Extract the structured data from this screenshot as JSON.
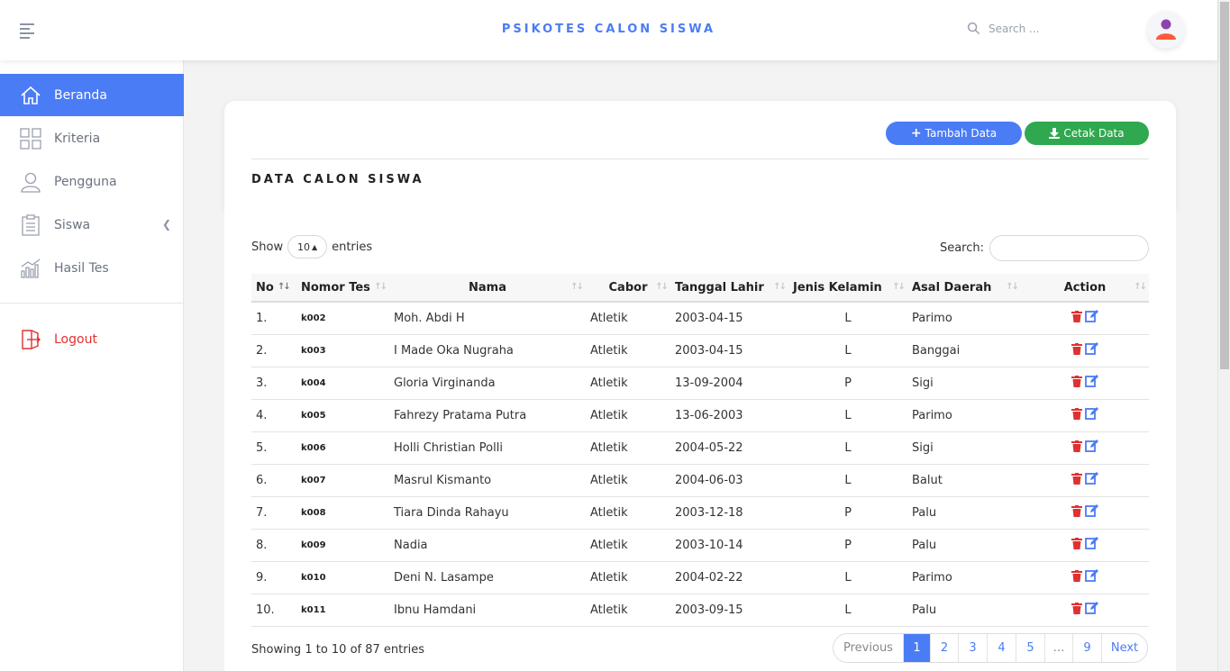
{
  "app": {
    "title": "PSIKOTES CALON SISWA"
  },
  "header": {
    "search_placeholder": "Search ..."
  },
  "sidebar": {
    "items": [
      {
        "label": "Beranda",
        "icon": "home-icon"
      },
      {
        "label": "Kriteria",
        "icon": "grid-icon"
      },
      {
        "label": "Pengguna",
        "icon": "user-icon"
      },
      {
        "label": "Siswa",
        "icon": "clipboard-icon"
      },
      {
        "label": "Hasil Tes",
        "icon": "bar-chart-icon"
      }
    ],
    "logout": "Logout"
  },
  "card": {
    "add_label": "Tambah Data",
    "print_label": "Cetak Data",
    "title": "DATA CALON SISWA"
  },
  "table": {
    "show_label": "Show",
    "entries_label": "entries",
    "page_size": "10",
    "search_label": "Search:",
    "columns": [
      "No",
      "Nomor Tes",
      "Nama",
      "Cabor",
      "Tanggal Lahir",
      "Jenis Kelamin",
      "Asal Daerah",
      "Action"
    ],
    "rows": [
      {
        "no": "1.",
        "code": "k002",
        "nama": "Moh. Abdi H",
        "cabor": "Atletik",
        "tgl": "2003-04-15",
        "jk": "L",
        "asal": "Parimo"
      },
      {
        "no": "2.",
        "code": "k003",
        "nama": "I Made Oka Nugraha",
        "cabor": "Atletik",
        "tgl": "2003-04-15",
        "jk": "L",
        "asal": "Banggai"
      },
      {
        "no": "3.",
        "code": "k004",
        "nama": "Gloria Virginanda",
        "cabor": "Atletik",
        "tgl": "13-09-2004",
        "jk": "P",
        "asal": "Sigi"
      },
      {
        "no": "4.",
        "code": "k005",
        "nama": "Fahrezy Pratama Putra",
        "cabor": "Atletik",
        "tgl": "13-06-2003",
        "jk": "L",
        "asal": "Parimo"
      },
      {
        "no": "5.",
        "code": "k006",
        "nama": "Holli Christian Polli",
        "cabor": "Atletik",
        "tgl": "2004-05-22",
        "jk": "L",
        "asal": "Sigi"
      },
      {
        "no": "6.",
        "code": "k007",
        "nama": "Masrul Kismanto",
        "cabor": "Atletik",
        "tgl": "2004-06-03",
        "jk": "L",
        "asal": "Balut"
      },
      {
        "no": "7.",
        "code": "k008",
        "nama": "Tiara Dinda Rahayu",
        "cabor": "Atletik",
        "tgl": "2003-12-18",
        "jk": "P",
        "asal": "Palu"
      },
      {
        "no": "8.",
        "code": "k009",
        "nama": "Nadia",
        "cabor": "Atletik",
        "tgl": "2003-10-14",
        "jk": "P",
        "asal": "Palu"
      },
      {
        "no": "9.",
        "code": "k010",
        "nama": "Deni N. Lasampe",
        "cabor": "Atletik",
        "tgl": "2004-02-22",
        "jk": "L",
        "asal": "Parimo"
      },
      {
        "no": "10.",
        "code": "k011",
        "nama": "Ibnu Hamdani",
        "cabor": "Atletik",
        "tgl": "2003-09-15",
        "jk": "L",
        "asal": "Palu"
      }
    ],
    "info": "Showing 1 to 10 of 87 entries"
  },
  "pagination": {
    "previous": "Previous",
    "next": "Next",
    "pages": [
      "1",
      "2",
      "3",
      "4",
      "5",
      "…",
      "9"
    ],
    "current": "1"
  },
  "colors": {
    "primary": "#4a7cf6",
    "success": "#2fa84f",
    "danger": "#e03131"
  }
}
